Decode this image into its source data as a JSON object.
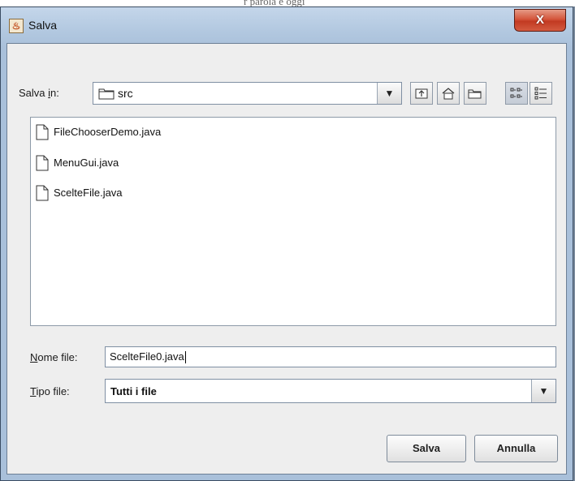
{
  "window": {
    "title": "Salva",
    "close_glyph": "X",
    "app_icon": "java-cup-icon"
  },
  "background_text": "r parola e oggi",
  "look_in": {
    "label_pre": "Salva ",
    "label_mnemonic": "i",
    "label_post": "n:",
    "selected": "src"
  },
  "toolbar": [
    "up-folder-icon",
    "home-icon",
    "new-folder-icon",
    "list-view-icon",
    "details-view-icon"
  ],
  "files": [
    {
      "name": "FileChooserDemo.java"
    },
    {
      "name": "MenuGui.java"
    },
    {
      "name": "ScelteFile.java"
    }
  ],
  "filename": {
    "label_mnemonic": "N",
    "label_rest": "ome file:",
    "value": "ScelteFile0.java"
  },
  "filetype": {
    "label_mnemonic": "T",
    "label_rest": "ipo file:",
    "selected": "Tutti i file"
  },
  "buttons": {
    "save": "Salva",
    "cancel": "Annulla"
  },
  "colors": {
    "close_button": "#c23a22",
    "frame": "#b2c8e0"
  }
}
